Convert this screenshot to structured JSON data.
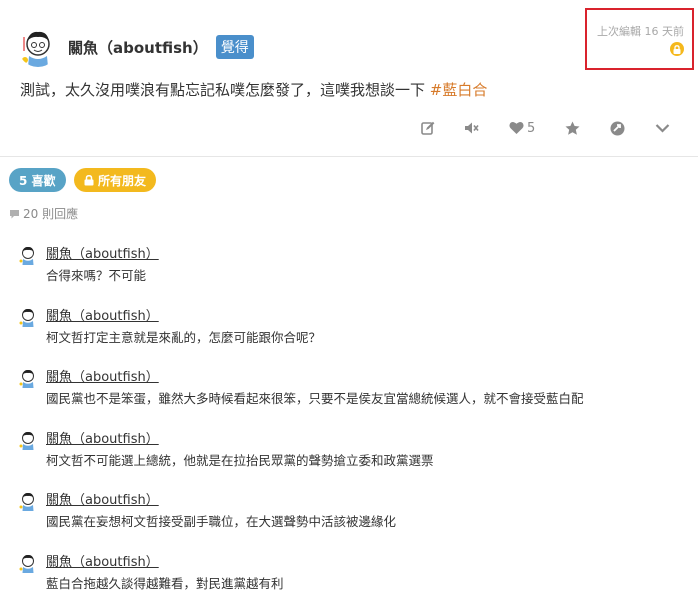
{
  "post": {
    "author": "關魚（aboutfish）",
    "qualifier": "覺得",
    "last_edited": "上次編輯 16 天前",
    "content": "測試，太久沒用噗浪有點忘記私噗怎麼發了，這噗我想談一下",
    "hashtag": "#藍白合",
    "like_count": "5"
  },
  "badges": {
    "likes": "5 喜歡",
    "privacy": "所有朋友"
  },
  "replies": {
    "count_label": "20 則回應",
    "items": [
      {
        "author": "關魚（aboutfish）",
        "text": "合得來嗎？不可能"
      },
      {
        "author": "關魚（aboutfish）",
        "text": "柯文哲打定主意就是來亂的，怎麼可能跟你合呢？"
      },
      {
        "author": "關魚（aboutfish）",
        "text": "國民黨也不是笨蛋，雖然大多時候看起來很笨，只要不是侯友宜當總統候選人，就不會接受藍白配"
      },
      {
        "author": "關魚（aboutfish）",
        "text": "柯文哲不可能選上總統，他就是在拉抬民眾黨的聲勢搶立委和政黨選票"
      },
      {
        "author": "關魚（aboutfish）",
        "text": "國民黨在妄想柯文哲接受副手職位，在大選聲勢中活該被邊緣化"
      },
      {
        "author": "關魚（aboutfish）",
        "text": "藍白合拖越久談得越難看，對民進黨越有利"
      }
    ]
  },
  "colors": {
    "qualifier_bg": "#4a8fcb",
    "hashtag": "#d77b2b",
    "likes_badge": "#58a3c6",
    "privacy_badge": "#f3b91e",
    "highlight_box": "#d9232d"
  },
  "icons": {
    "edit": "edit-icon",
    "mute": "mute-icon",
    "like": "heart-icon",
    "favorite": "star-icon",
    "replurk": "replurk-icon",
    "more": "chevron-down-icon",
    "lock": "lock-icon",
    "comment": "comment-icon"
  }
}
